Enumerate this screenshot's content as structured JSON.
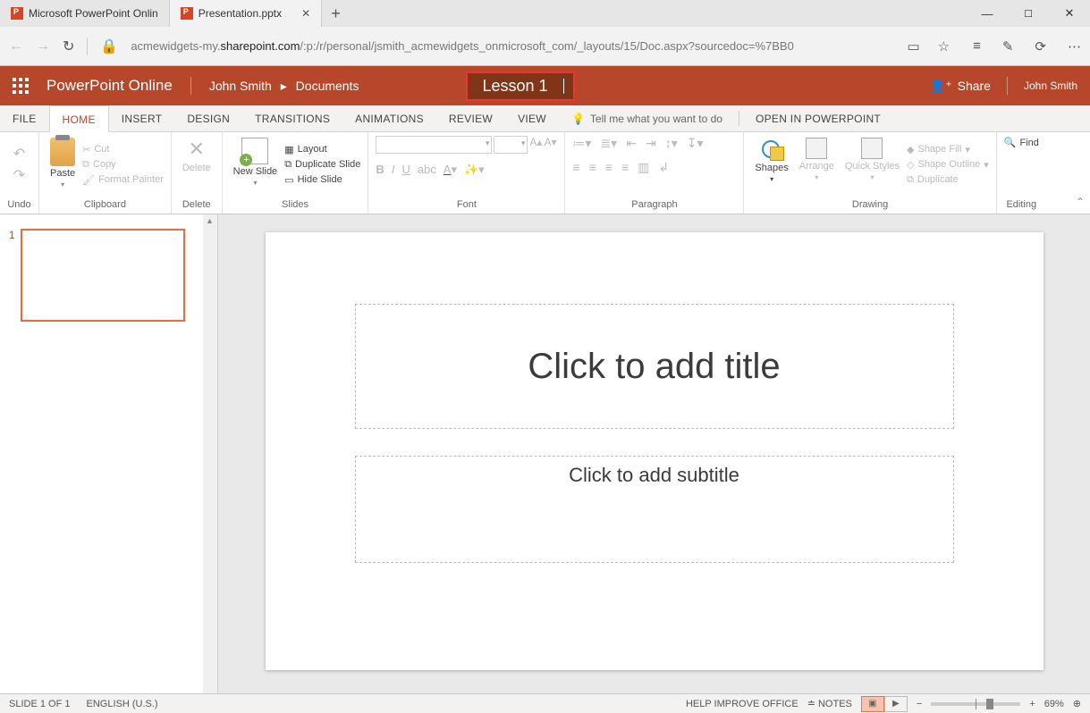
{
  "browser": {
    "tabs": [
      {
        "label": "Microsoft PowerPoint Onlin"
      },
      {
        "label": "Presentation.pptx"
      }
    ],
    "url_pre": "acmewidgets-my.",
    "url_strong": "sharepoint.com",
    "url_post": "/:p:/r/personal/jsmith_acmewidgets_onmicrosoft_com/_layouts/15/Doc.aspx?sourcedoc=%7BB0"
  },
  "header": {
    "app": "PowerPoint Online",
    "user": "John Smith",
    "crumb": "Documents",
    "filename": "Lesson 1",
    "share": "Share",
    "account": "John Smith"
  },
  "tabs": {
    "file": "FILE",
    "home": "HOME",
    "insert": "INSERT",
    "design": "DESIGN",
    "transitions": "TRANSITIONS",
    "animations": "ANIMATIONS",
    "review": "REVIEW",
    "view": "VIEW",
    "tell": "Tell me what you want to do",
    "open": "OPEN IN POWERPOINT"
  },
  "ribbon": {
    "undo": "Undo",
    "clipboard": "Clipboard",
    "delete": "Delete",
    "slides": "Slides",
    "font": "Font",
    "paragraph": "Paragraph",
    "drawing": "Drawing",
    "editing": "Editing",
    "paste": "Paste",
    "cut": "Cut",
    "copy": "Copy",
    "formatp": "Format Painter",
    "delbtn": "Delete",
    "newslide": "New Slide",
    "layout": "Layout",
    "dup": "Duplicate Slide",
    "hide": "Hide Slide",
    "shapes": "Shapes",
    "arrange": "Arrange",
    "quick": "Quick Styles",
    "sfill": "Shape Fill",
    "soutline": "Shape Outline",
    "sdup": "Duplicate",
    "find": "Find"
  },
  "canvas": {
    "slidenum": "1",
    "title_ph": "Click to add title",
    "sub_ph": "Click to add subtitle"
  },
  "status": {
    "slide": "SLIDE 1 OF 1",
    "lang": "ENGLISH (U.S.)",
    "help": "HELP IMPROVE OFFICE",
    "notes": "NOTES",
    "zoom": "69%"
  }
}
